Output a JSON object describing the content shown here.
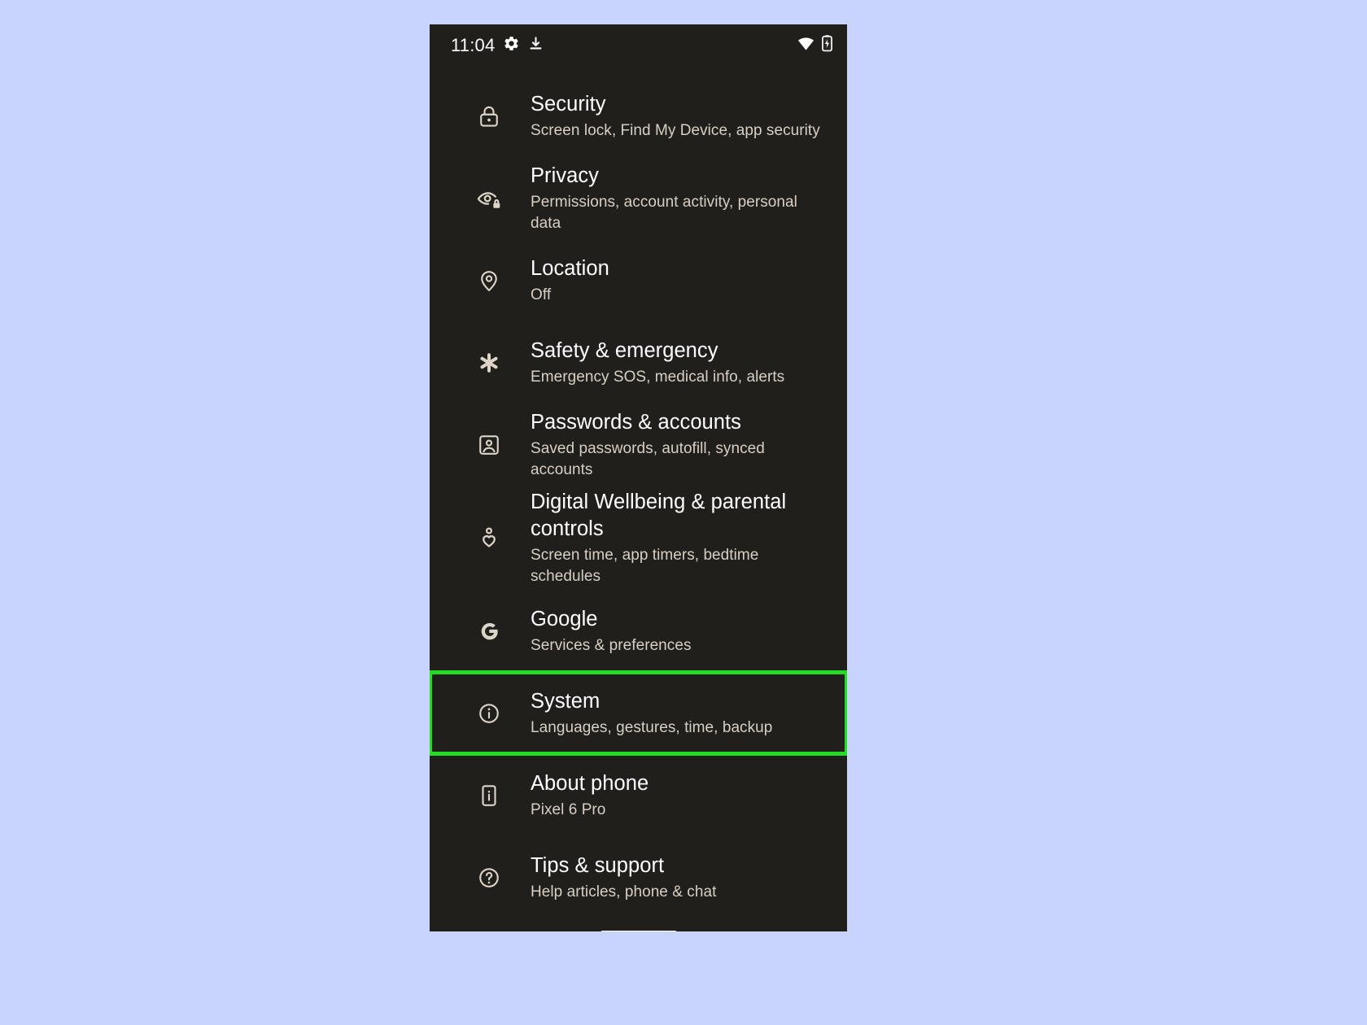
{
  "background_color": "#c9d4fd",
  "screen_background_color": "#201f1c",
  "highlight_color": "#22dd22",
  "status_bar": {
    "clock": "11:04",
    "left_icons": [
      "gear-icon",
      "download-icon"
    ],
    "right_icons": [
      "wifi-icon",
      "battery-icon"
    ]
  },
  "settings": {
    "items": [
      {
        "icon": "lock-icon",
        "title": "Security",
        "subtitle": "Screen lock, Find My Device, app security",
        "highlighted": false
      },
      {
        "icon": "eye-lock-icon",
        "title": "Privacy",
        "subtitle": "Permissions, account activity, personal data",
        "highlighted": false
      },
      {
        "icon": "location-pin-icon",
        "title": "Location",
        "subtitle": "Off",
        "highlighted": false
      },
      {
        "icon": "asterisk-icon",
        "title": "Safety & emergency",
        "subtitle": "Emergency SOS, medical info, alerts",
        "highlighted": false
      },
      {
        "icon": "account-box-icon",
        "title": "Passwords & accounts",
        "subtitle": "Saved passwords, autofill, synced accounts",
        "highlighted": false
      },
      {
        "icon": "heart-person-icon",
        "title": "Digital Wellbeing & parental\ncontrols",
        "subtitle": "Screen time, app timers, bedtime schedules",
        "highlighted": false
      },
      {
        "icon": "google-g-icon",
        "title": "Google",
        "subtitle": "Services & preferences",
        "highlighted": false
      },
      {
        "icon": "info-circle-icon",
        "title": "System",
        "subtitle": "Languages, gestures, time, backup",
        "highlighted": true
      },
      {
        "icon": "phone-info-icon",
        "title": "About phone",
        "subtitle": "Pixel 6 Pro",
        "highlighted": false
      },
      {
        "icon": "help-circle-icon",
        "title": "Tips & support",
        "subtitle": "Help articles, phone & chat",
        "highlighted": false
      }
    ]
  },
  "home_indicator": {
    "label": "home-indicator"
  }
}
